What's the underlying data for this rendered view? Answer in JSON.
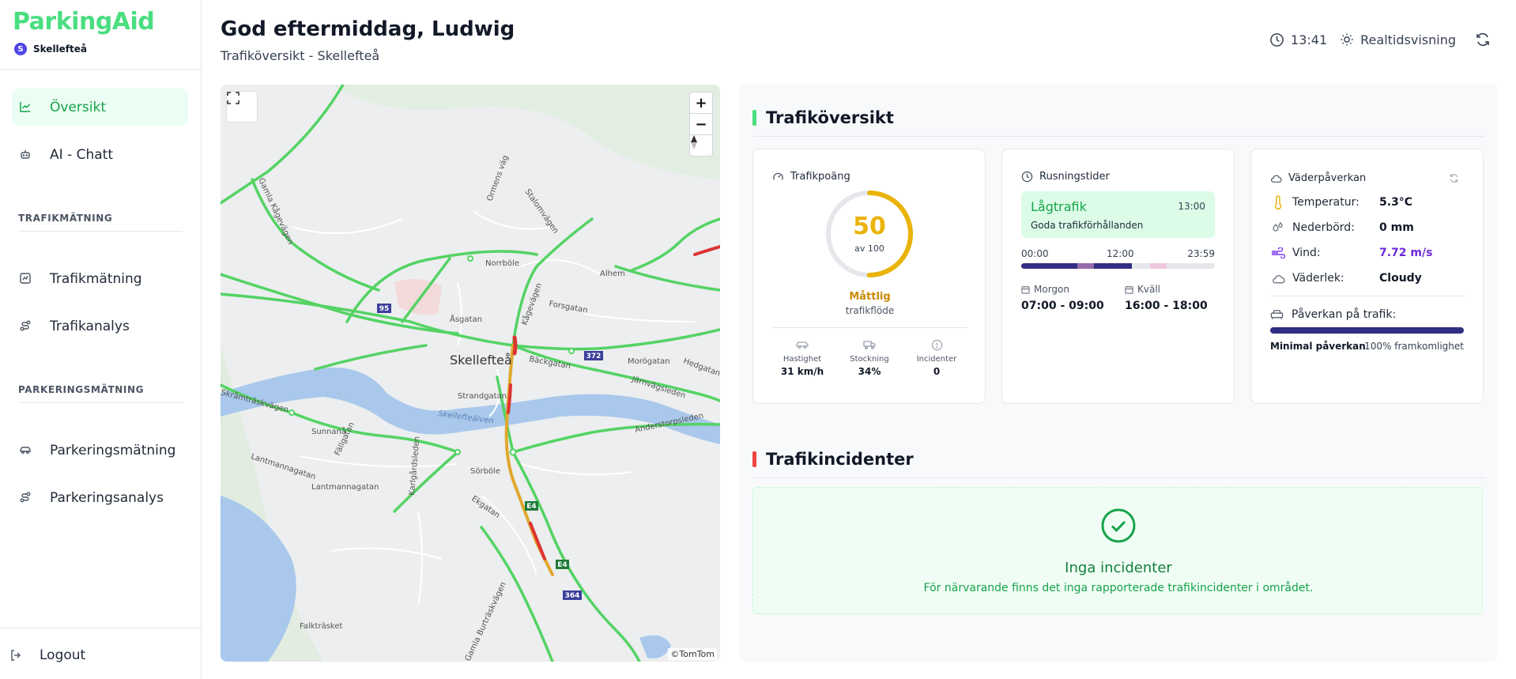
{
  "app": {
    "brand": "ParkingAid",
    "city_initial": "S",
    "city": "Skellefteå"
  },
  "sidebar": {
    "items": [
      {
        "label": "Översikt",
        "icon": "chart-line-icon",
        "active": true
      },
      {
        "label": "AI - Chatt",
        "icon": "bot-icon",
        "active": false
      }
    ],
    "section_traffic": "TRAFIKMÄTNING",
    "traffic_items": [
      {
        "label": "Trafikmätning",
        "icon": "chart-box-icon"
      },
      {
        "label": "Trafikanalys",
        "icon": "route-icon"
      }
    ],
    "section_parking": "PARKERINGSMÄTNING",
    "parking_items": [
      {
        "label": "Parkeringsmätning",
        "icon": "car-icon"
      },
      {
        "label": "Parkeringsanalys",
        "icon": "route-icon"
      }
    ],
    "logout": "Logout"
  },
  "header": {
    "greeting": "God eftermiddag, Ludwig",
    "subtitle": "Trafiköversikt - Skellefteå",
    "time": "13:41",
    "mode": "Realtidsvisning"
  },
  "map": {
    "attribution": "©TomTom",
    "labels": {
      "skelleftea": "Skellefteå",
      "asgatan": "Åsgatan",
      "norrbole": "Norrböle",
      "alhem": "Alhem",
      "forsgatan": "Forsgatan",
      "kagevagen": "Kågevägen",
      "morogatan": "Morögatan",
      "hedgatan": "Hedgatan",
      "jarnvagsleden": "Järnvägsleden",
      "backgatan": "Bäckgatan",
      "strandgatan": "Strandgatan",
      "skellefteälven": "Skellefteälven",
      "anderstorpsleden": "Anderstorpsleden",
      "skramtraskvagen": "Skråmträskvägen",
      "sunnana": "Sunnanå",
      "fallgatan": "Fällgatan",
      "lantmannagatan": "Lantmannagatan",
      "karlgardsleden": "Karlgårdsleden",
      "sorbole": "Sörböle",
      "ekgatan": "Ekgatan",
      "gamla_burtraskvagen": "Gamla Burträskvägen",
      "falktrasket": "Falkträsket",
      "gamla_kagevagen": "Gamla Kågevägen",
      "ormens_vag": "Ormens väg",
      "stalomvagen": "Stalomvägen",
      "r95": "95",
      "r372": "372",
      "e4a": "E4",
      "e4b": "E4",
      "r364": "364"
    }
  },
  "overview": {
    "title": "Trafiköversikt",
    "accent": "#4ade80",
    "score_card": {
      "title": "Trafikpoäng",
      "score": 50,
      "score_max": 100,
      "of_label": "av 100",
      "state": "Måttlig",
      "state_sub": "trafikflöde",
      "stats": [
        {
          "label": "Hastighet",
          "value": "31 km/h",
          "icon": "car-icon"
        },
        {
          "label": "Stockning",
          "value": "34%",
          "icon": "truck-icon"
        },
        {
          "label": "Incidenter",
          "value": "0",
          "icon": "alert-circle-icon"
        }
      ]
    },
    "rush_card": {
      "title": "Rusningstider",
      "status": "Lågtrafik",
      "status_time": "13:00",
      "status_desc": "Goda trafikförhållanden",
      "tl_start": "00:00",
      "tl_mid": "12:00",
      "tl_end": "23:59",
      "now_fraction": 0.57,
      "morning_label": "Morgon",
      "morning_value": "07:00 - 09:00",
      "evening_label": "Kväll",
      "evening_value": "16:00 - 18:00"
    },
    "weather_card": {
      "title": "Väderpåverkan",
      "rows": [
        {
          "label": "Temperatur:",
          "value": "5.3°C",
          "icon": "thermometer-icon"
        },
        {
          "label": "Nederbörd:",
          "value": "0 mm",
          "icon": "droplets-icon"
        },
        {
          "label": "Vind:",
          "value": "7.72 m/s",
          "icon": "wind-icon"
        },
        {
          "label": "Väderlek:",
          "value": "Cloudy",
          "icon": "cloud-icon"
        }
      ],
      "impact_label": "Påverkan på trafik:",
      "impact_fraction": 1.0,
      "impact_left": "Minimal påverkan",
      "impact_right": "100% framkomlighet"
    }
  },
  "incidents": {
    "title": "Trafikincidenter",
    "accent": "#ef4444",
    "empty_title": "Inga incidenter",
    "empty_desc": "För närvarande finns det inga rapporterade trafikincidenter i området."
  }
}
